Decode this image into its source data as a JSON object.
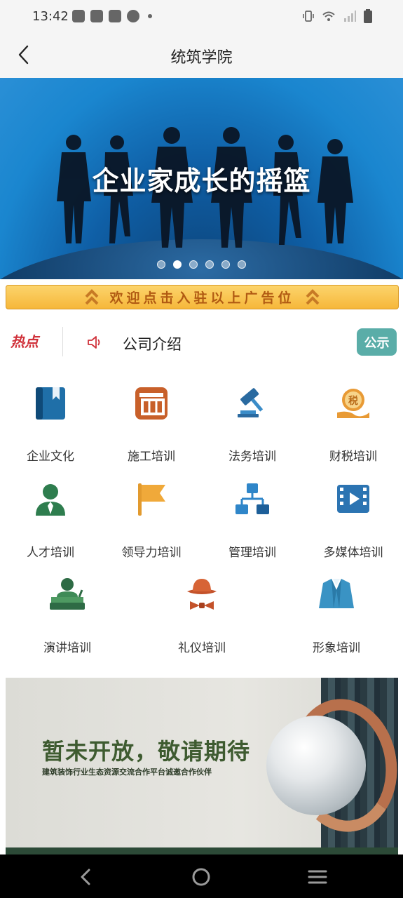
{
  "status_bar": {
    "time": "13:42"
  },
  "header": {
    "title": "统筑学院"
  },
  "banner": {
    "text": "企业家成长的摇篮",
    "slide_count": 6,
    "active_slide": 2
  },
  "ad_strip": {
    "text": "欢迎点击入驻以上广告位"
  },
  "hot": {
    "logo": "热点",
    "headline": "公司介绍",
    "notice_button": "公示"
  },
  "categories": [
    {
      "label": "企业文化",
      "icon": "book-icon"
    },
    {
      "label": "施工培训",
      "icon": "construction-icon"
    },
    {
      "label": "法务培训",
      "icon": "gavel-icon"
    },
    {
      "label": "财税培训",
      "icon": "tax-icon"
    },
    {
      "label": "人才培训",
      "icon": "person-icon"
    },
    {
      "label": "领导力培训",
      "icon": "flag-icon"
    },
    {
      "label": "管理培训",
      "icon": "org-chart-icon"
    },
    {
      "label": "多媒体培训",
      "icon": "video-icon"
    },
    {
      "label": "演讲培训",
      "icon": "podium-icon"
    },
    {
      "label": "礼仪培训",
      "icon": "hat-bowtie-icon"
    },
    {
      "label": "形象培训",
      "icon": "suit-icon"
    }
  ],
  "promo": {
    "title": "暂未开放，敬请期待",
    "subtitle": "建筑装饰行业生态资源交流合作平台诚邀合作伙伴"
  },
  "colors": {
    "header_bg": "#f5f5f5",
    "notice_bg": "#5aada8",
    "ad_text": "#b15a12",
    "hot_red": "#d0313a"
  }
}
